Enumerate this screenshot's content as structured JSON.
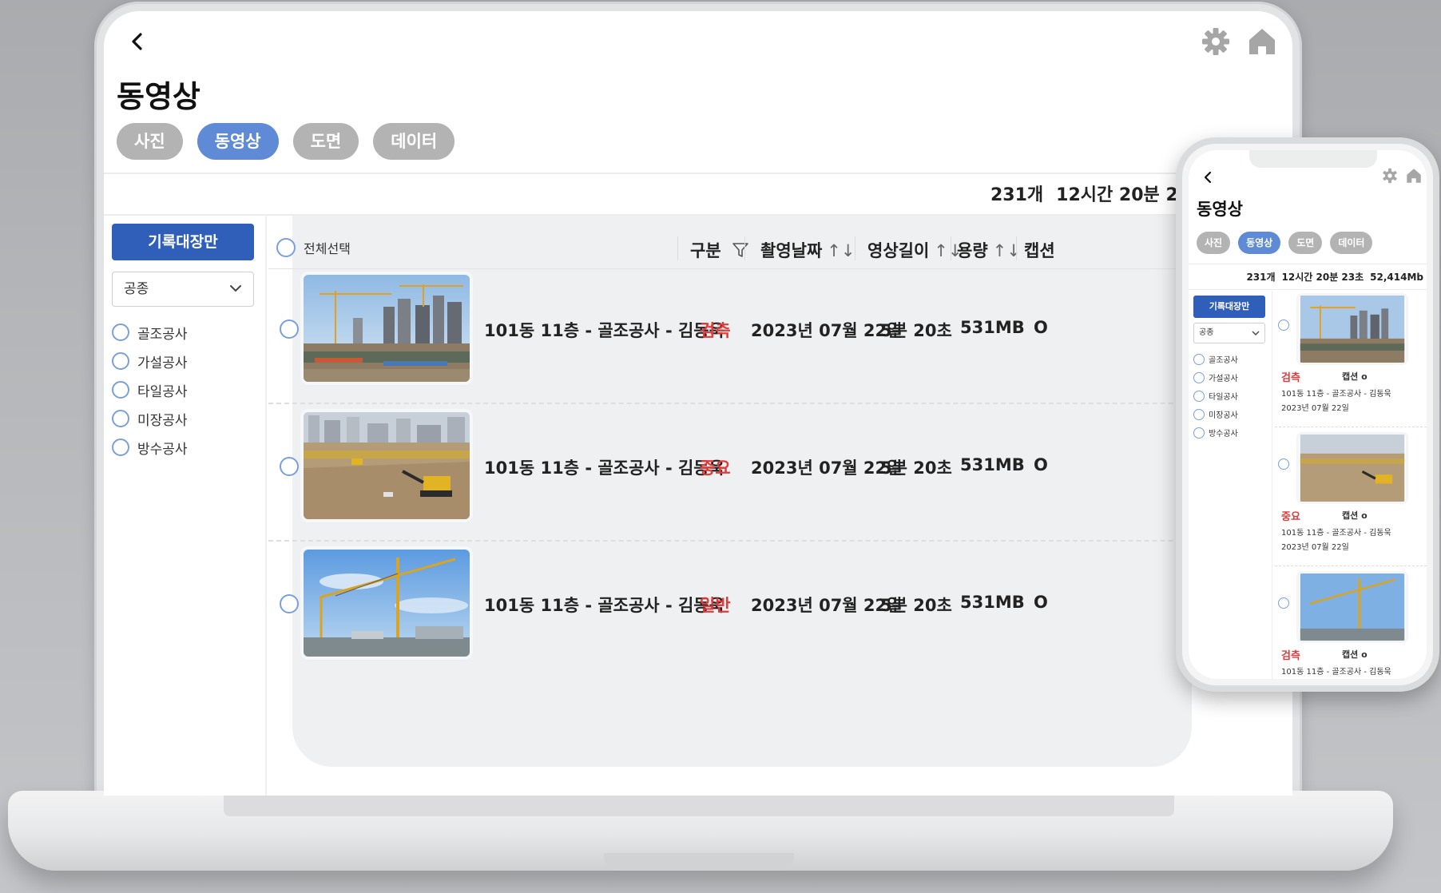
{
  "laptop": {
    "back_icon": "chevron-left-icon",
    "page_title": "동영상",
    "tabs": [
      {
        "label": "사진",
        "active": false
      },
      {
        "label": "동영상",
        "active": true
      },
      {
        "label": "도면",
        "active": false
      },
      {
        "label": "데이터",
        "active": false
      }
    ],
    "summary": {
      "count": "231개",
      "duration": "12시간 20분 23:"
    },
    "sidebar": {
      "record_button": "기록대장만",
      "select_value": "공종",
      "filters": [
        "골조공사",
        "가설공사",
        "타일공사",
        "미장공사",
        "방수공사"
      ]
    },
    "table": {
      "select_all": "전체선택",
      "headers": {
        "category": "구분",
        "date": "촬영날짜",
        "length": "영상길이",
        "size": "용량",
        "caption": "캡션"
      },
      "rows": [
        {
          "title": "101동 11층 - 골조공사 - 김동욱",
          "category": "검측",
          "date": "2023년 07월 22일",
          "length": "5분 20초",
          "size": "531MB",
          "caption": "O",
          "scene": "towers"
        },
        {
          "title": "101동 11층 - 골조공사 - 김동욱",
          "category": "중요",
          "date": "2023년 07월 22일",
          "length": "5분 20초",
          "size": "531MB",
          "caption": "O",
          "scene": "excavation"
        },
        {
          "title": "101동 11층 - 골조공사 - 김동욱",
          "category": "일반",
          "date": "2023년 07월 22일",
          "length": "5분 20초",
          "size": "531MB",
          "caption": "O",
          "scene": "crane"
        }
      ]
    }
  },
  "phone": {
    "page_title": "동영상",
    "tabs": [
      {
        "label": "사진",
        "active": false
      },
      {
        "label": "동영상",
        "active": true
      },
      {
        "label": "도면",
        "active": false
      },
      {
        "label": "데이터",
        "active": false
      }
    ],
    "summary": {
      "count": "231개",
      "duration": "12시간 20분 23초",
      "size": "52,414Mb"
    },
    "sidebar": {
      "record_button": "기록대장만",
      "select_value": "공종",
      "filters": [
        "골조공사",
        "가설공사",
        "타일공사",
        "미장공사",
        "방수공사"
      ]
    },
    "cards": [
      {
        "category": "검측",
        "caption": "캡션 o",
        "title": "101동 11층 - 골조공사 - 김동욱",
        "date": "2023년 07월 22일"
      },
      {
        "category": "중요",
        "caption": "캡션 o",
        "title": "101동 11층 - 골조공사 - 김동욱",
        "date": "2023년 07월 22일"
      },
      {
        "category": "검측",
        "caption": "캡션 o",
        "title": "101동 11층 - 골조공사 - 김동욱",
        "date": ""
      }
    ]
  },
  "colors": {
    "accent": "#2f5fb8",
    "tab_active": "#5e8ad6",
    "tab_inactive": "#b3b3b3",
    "badge_red": "#e03b3b"
  }
}
